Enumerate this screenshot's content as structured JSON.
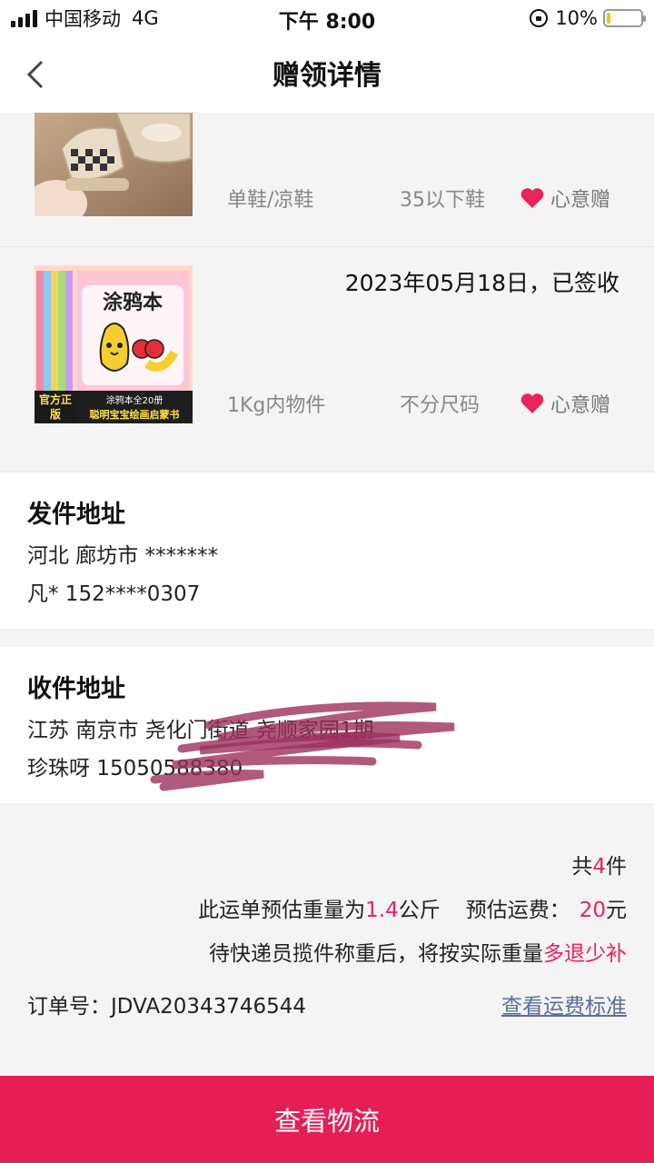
{
  "status_bar": {
    "carrier": "中国移动",
    "network": "4G",
    "time": "下午 8:00",
    "battery": "10%",
    "battery_level": 0.1
  },
  "nav": {
    "title": "赠领详情",
    "back_icon": "chevron-left-icon"
  },
  "items": [
    {
      "category": "单鞋/凉鞋",
      "size": "35以下鞋",
      "gift_type": "心意赠",
      "image": "sandals-photo"
    },
    {
      "date_status": "2023年05月18日，已签收",
      "category": "1Kg内物件",
      "size": "不分尺码",
      "gift_type": "心意赠",
      "image": "coloring-book-photo",
      "image_text": {
        "title": "涂鸦本",
        "badge": "官方正版",
        "line1": "涂鸦本全20册",
        "line2": "聪明宝宝绘画启蒙书"
      }
    }
  ],
  "sender": {
    "title": "发件地址",
    "region": "河北 廊坊市 *******",
    "contact": "凡* 152****0307"
  },
  "receiver": {
    "title": "收件地址",
    "region": "江苏 南京市 尧化门街道 尧顺家园1期",
    "contact": "珍珠呀 15050588380"
  },
  "summary": {
    "count_prefix": "共",
    "count": "4",
    "count_suffix": "件",
    "weight_prefix": "此运单预估重量为",
    "weight": "1.4",
    "weight_unit": "公斤",
    "fee_prefix": "预估运费：",
    "fee": "20",
    "fee_unit": "元",
    "note_prefix": "待快递员揽件称重后，将按实际重量",
    "note_accent": "多退少补",
    "order_label": "订单号：JDVA20343746544",
    "fee_link": "查看运费标准"
  },
  "bottom_button": "查看物流",
  "colors": {
    "accent": "#e8245a",
    "button": "#e61e55",
    "link": "#5a6f9a"
  }
}
